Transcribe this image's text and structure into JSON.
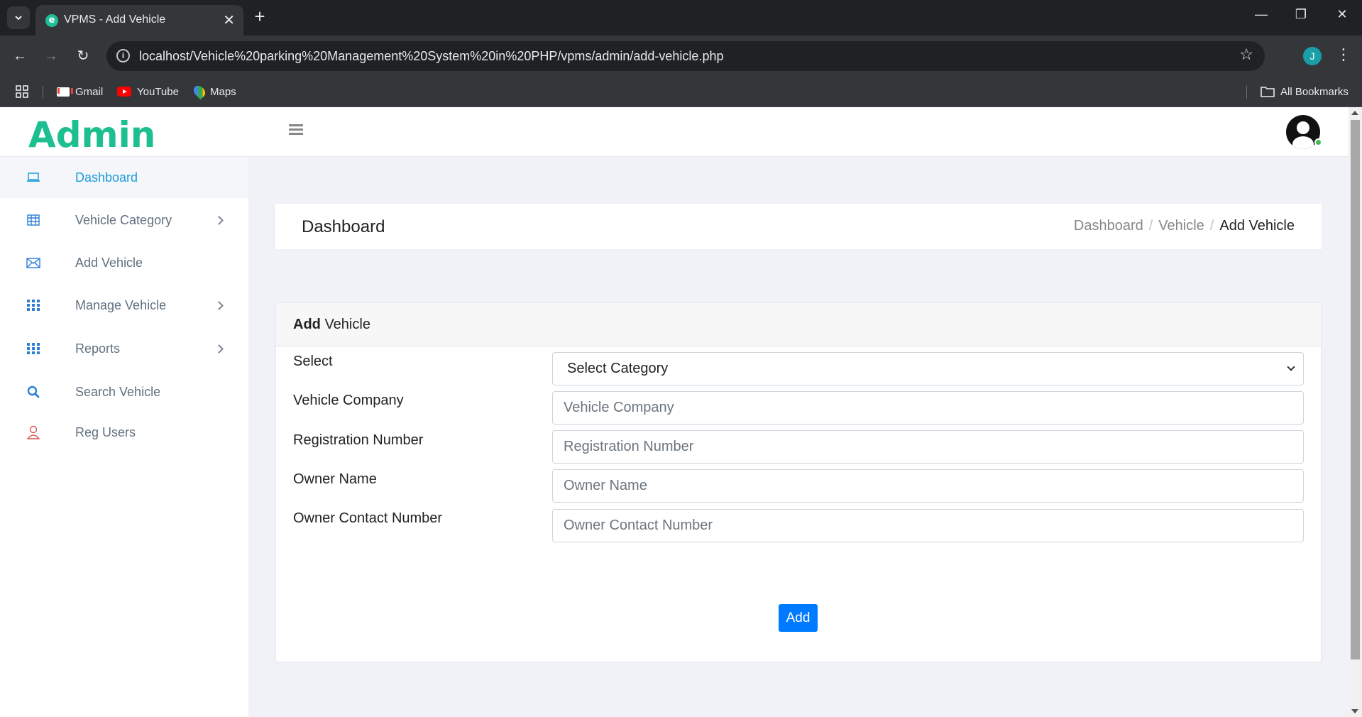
{
  "browser": {
    "tab_title": "VPMS - Add Vehicle",
    "url": "localhost/Vehicle%20parking%20Management%20System%20in%20PHP/vpms/admin/add-vehicle.php",
    "profile_initial": "J",
    "bookmarks": [
      {
        "label": "Gmail",
        "icon": "gmail-icon"
      },
      {
        "label": "YouTube",
        "icon": "youtube-icon"
      },
      {
        "label": "Maps",
        "icon": "maps-icon"
      }
    ],
    "all_bookmarks": "All Bookmarks"
  },
  "header": {
    "brand": "Admin"
  },
  "sidebar": {
    "items": [
      {
        "label": "Dashboard",
        "icon": "laptop-icon",
        "active": true,
        "has_submenu": false
      },
      {
        "label": "Vehicle Category",
        "icon": "table-icon",
        "active": false,
        "has_submenu": true
      },
      {
        "label": "Add Vehicle",
        "icon": "envelope-icon",
        "active": false,
        "has_submenu": false
      },
      {
        "label": "Manage Vehicle",
        "icon": "grid-icon",
        "active": false,
        "has_submenu": true
      },
      {
        "label": "Reports",
        "icon": "grid-icon",
        "active": false,
        "has_submenu": true
      },
      {
        "label": "Search Vehicle",
        "icon": "search-icon",
        "active": false,
        "has_submenu": false
      },
      {
        "label": "Reg Users",
        "icon": "user-icon",
        "active": false,
        "has_submenu": false
      }
    ]
  },
  "page_header": {
    "title": "Dashboard",
    "breadcrumb": [
      "Dashboard",
      "Vehicle",
      "Add Vehicle"
    ]
  },
  "form": {
    "heading_bold": "Add",
    "heading_rest": " Vehicle",
    "fields": [
      {
        "label": "Select",
        "type": "select",
        "value": "Select Category"
      },
      {
        "label": "Vehicle Company",
        "type": "text",
        "placeholder": "Vehicle Company"
      },
      {
        "label": "Registration Number",
        "type": "text",
        "placeholder": "Registration Number"
      },
      {
        "label": "Owner Name",
        "type": "text",
        "placeholder": "Owner Name"
      },
      {
        "label": "Owner Contact Number",
        "type": "text",
        "placeholder": "Owner Contact Number"
      }
    ],
    "submit_label": "Add"
  },
  "colors": {
    "brand": "#1dbf91",
    "active_nav": "#1d9dd8",
    "primary_button": "#007bff",
    "nav_icon_blue": "#2b7fd9",
    "nav_icon_red": "#d9534f"
  }
}
